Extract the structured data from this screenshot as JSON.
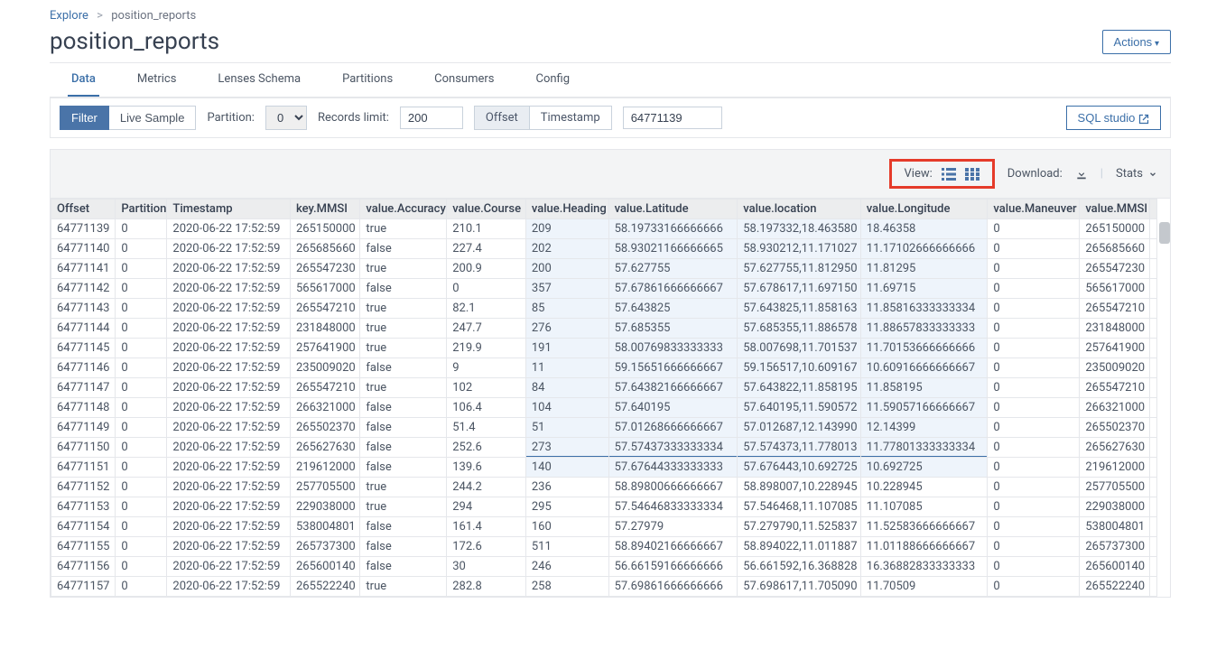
{
  "breadcrumb": {
    "root": "Explore",
    "current": "position_reports"
  },
  "title": "position_reports",
  "actions_label": "Actions",
  "tabs": [
    "Data",
    "Metrics",
    "Lenses Schema",
    "Partitions",
    "Consumers",
    "Config"
  ],
  "filter": {
    "filter_btn": "Filter",
    "live_btn": "Live Sample",
    "partition_label": "Partition:",
    "partition_value": "0",
    "records_label": "Records limit:",
    "records_value": "200",
    "offset_btn": "Offset",
    "timestamp_btn": "Timestamp",
    "offset_value": "64771139",
    "sql_studio": "SQL studio"
  },
  "toolbar": {
    "view_label": "View:",
    "download_label": "Download:",
    "stats_label": "Stats"
  },
  "columns": [
    "Offset",
    "Partition",
    "Timestamp",
    "key.MMSI",
    "value.Accuracy",
    "value.Course",
    "value.Heading",
    "value.Latitude",
    "value.location",
    "value.Longitude",
    "value.Maneuver",
    "value.MMSI"
  ],
  "rows": [
    [
      "64771139",
      "0",
      "2020-06-22 17:52:59",
      "265150000",
      "true",
      "210.1",
      "209",
      "58.19733166666666",
      "58.197332,18.463580",
      "18.46358",
      "0",
      "265150000"
    ],
    [
      "64771140",
      "0",
      "2020-06-22 17:52:59",
      "265685660",
      "false",
      "227.4",
      "202",
      "58.93021166666665",
      "58.930212,11.171027",
      "11.17102666666666",
      "0",
      "265685660"
    ],
    [
      "64771141",
      "0",
      "2020-06-22 17:52:59",
      "265547230",
      "true",
      "200.9",
      "200",
      "57.627755",
      "57.627755,11.812950",
      "11.81295",
      "0",
      "265547230"
    ],
    [
      "64771142",
      "0",
      "2020-06-22 17:52:59",
      "565617000",
      "false",
      "0",
      "357",
      "57.67861666666667",
      "57.678617,11.697150",
      "11.69715",
      "0",
      "565617000"
    ],
    [
      "64771143",
      "0",
      "2020-06-22 17:52:59",
      "265547210",
      "true",
      "82.1",
      "85",
      "57.643825",
      "57.643825,11.858163",
      "11.85816333333334",
      "0",
      "265547210"
    ],
    [
      "64771144",
      "0",
      "2020-06-22 17:52:59",
      "231848000",
      "true",
      "247.7",
      "276",
      "57.685355",
      "57.685355,11.886578",
      "11.88657833333333",
      "0",
      "231848000"
    ],
    [
      "64771145",
      "0",
      "2020-06-22 17:52:59",
      "257641900",
      "true",
      "219.9",
      "191",
      "58.00769833333333",
      "58.007698,11.701537",
      "11.70153666666666",
      "0",
      "257641900"
    ],
    [
      "64771146",
      "0",
      "2020-06-22 17:52:59",
      "235009020",
      "false",
      "9",
      "11",
      "59.15651666666667",
      "59.156517,10.609167",
      "10.60916666666667",
      "0",
      "235009020"
    ],
    [
      "64771147",
      "0",
      "2020-06-22 17:52:59",
      "265547210",
      "true",
      "102",
      "84",
      "57.64382166666667",
      "57.643822,11.858195",
      "11.858195",
      "0",
      "265547210"
    ],
    [
      "64771148",
      "0",
      "2020-06-22 17:52:59",
      "266321000",
      "false",
      "106.4",
      "104",
      "57.640195",
      "57.640195,11.590572",
      "11.59057166666667",
      "0",
      "266321000"
    ],
    [
      "64771149",
      "0",
      "2020-06-22 17:52:59",
      "265502370",
      "false",
      "51.4",
      "51",
      "57.01268666666667",
      "57.012687,12.143990",
      "12.14399",
      "0",
      "265502370"
    ],
    [
      "64771150",
      "0",
      "2020-06-22 17:52:59",
      "265627630",
      "false",
      "252.6",
      "273",
      "57.57437333333334",
      "57.574373,11.778013",
      "11.77801333333334",
      "0",
      "265627630"
    ],
    [
      "64771151",
      "0",
      "2020-06-22 17:52:59",
      "219612000",
      "false",
      "139.6",
      "140",
      "57.67644333333333",
      "57.676443,10.692725",
      "10.692725",
      "0",
      "219612000"
    ],
    [
      "64771152",
      "0",
      "2020-06-22 17:52:59",
      "257705500",
      "true",
      "244.2",
      "236",
      "58.89800666666667",
      "58.898007,10.228945",
      "10.228945",
      "0",
      "257705500"
    ],
    [
      "64771153",
      "0",
      "2020-06-22 17:52:59",
      "229038000",
      "true",
      "294",
      "295",
      "57.54646833333334",
      "57.546468,11.107085",
      "11.107085",
      "0",
      "229038000"
    ],
    [
      "64771154",
      "0",
      "2020-06-22 17:52:59",
      "538004801",
      "false",
      "161.4",
      "160",
      "57.27979",
      "57.279790,11.525837",
      "11.52583666666667",
      "0",
      "538004801"
    ],
    [
      "64771155",
      "0",
      "2020-06-22 17:52:59",
      "265737300",
      "false",
      "172.6",
      "511",
      "58.89402166666667",
      "58.894022,11.011887",
      "11.01188666666667",
      "0",
      "265737300"
    ],
    [
      "64771156",
      "0",
      "2020-06-22 17:52:59",
      "265600140",
      "false",
      "30",
      "246",
      "56.66159166666666",
      "56.661592,16.368828",
      "16.36882833333333",
      "0",
      "265600140"
    ],
    [
      "64771157",
      "0",
      "2020-06-22 17:52:59",
      "265522240",
      "true",
      "282.8",
      "258",
      "57.69861666666666",
      "57.698617,11.705090",
      "11.70509",
      "0",
      "265522240"
    ]
  ]
}
